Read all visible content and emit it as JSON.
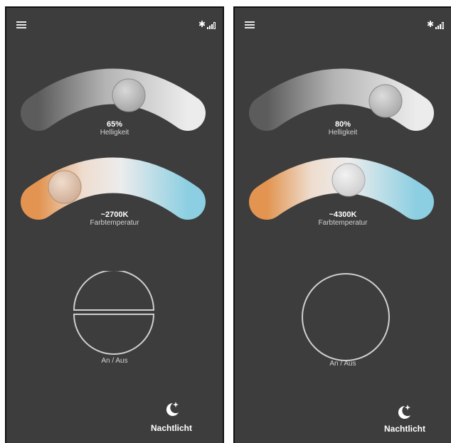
{
  "screens": [
    {
      "brightness": {
        "value": "65%",
        "label": "Helligkeit",
        "level": 0.65
      },
      "temperature": {
        "value": "~2700K",
        "label": "Farbtemperatur",
        "level": 0.2
      },
      "power": {
        "label": "An / Aus",
        "state": "split"
      },
      "nightlight": {
        "label": "Nachtlicht",
        "icon": "moon-stars-icon"
      },
      "status_icons": [
        "bluetooth-icon",
        "signal-icon"
      ],
      "menu_icon": "hamburger-menu-icon"
    },
    {
      "brightness": {
        "value": "80%",
        "label": "Helligkeit",
        "level": 0.8
      },
      "temperature": {
        "value": "~4300K",
        "label": "Farbtemperatur",
        "level": 0.58
      },
      "power": {
        "label": "An / Aus",
        "state": "ring"
      },
      "nightlight": {
        "label": "Nachtlicht",
        "icon": "moon-stars-icon"
      },
      "status_icons": [
        "bluetooth-icon",
        "signal-icon"
      ],
      "menu_icon": "hamburger-menu-icon"
    }
  ],
  "colors": {
    "background": "#3d3d3d",
    "warm": "#e49a5c",
    "cool": "#8fd0e4",
    "gray_dark": "#5e5e5e",
    "gray_light": "#e7e7e7"
  }
}
